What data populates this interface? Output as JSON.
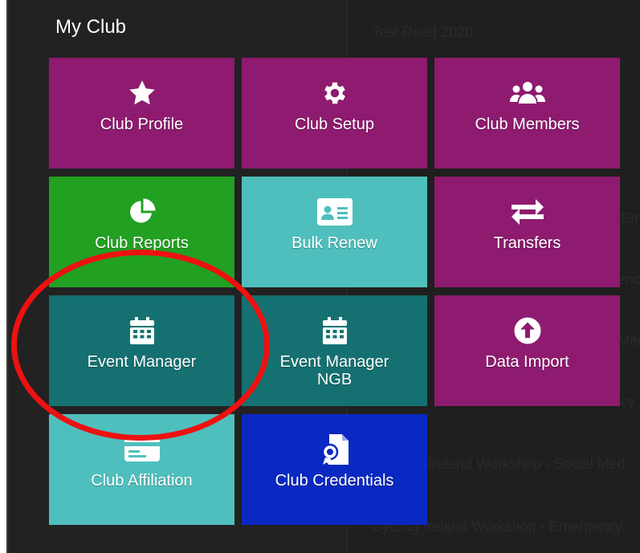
{
  "menu": {
    "title": "My Club",
    "tiles": [
      {
        "label": "Club Profile",
        "icon": "star-icon",
        "color": "#8e1b6f"
      },
      {
        "label": "Club Setup",
        "icon": "gear-icon",
        "color": "#8e1b6f"
      },
      {
        "label": "Club Members",
        "icon": "users-icon",
        "color": "#8e1b6f"
      },
      {
        "label": "Club Reports",
        "icon": "pie-chart-icon",
        "color": "#22a022"
      },
      {
        "label": "Bulk Renew",
        "icon": "id-card-icon",
        "color": "#4fbfbd"
      },
      {
        "label": "Transfers",
        "icon": "exchange-arrows-icon",
        "color": "#8e1b6f"
      },
      {
        "label": "Event Manager",
        "icon": "calendar-icon",
        "color": "#157171"
      },
      {
        "label": "Event Manager NGB",
        "icon": "calendar-icon",
        "color": "#157171"
      },
      {
        "label": "Data Import",
        "icon": "upload-circle-icon",
        "color": "#8e1b6f"
      },
      {
        "label": "Club Affiliation",
        "icon": "id-card-icon",
        "color": "#4fbfbd"
      },
      {
        "label": "Club Credentials",
        "icon": "certificate-icon",
        "color": "#0a29c2"
      }
    ]
  },
  "background_list": {
    "items": [
      "Test Road 2020",
      "Em",
      "ency",
      "Med",
      "ency",
      "Ireland Workshop - Social Med",
      "Cycling Ireland Workshop - Emergency"
    ]
  },
  "annotation": {
    "color": "#ee1111",
    "target": "Event Manager"
  }
}
